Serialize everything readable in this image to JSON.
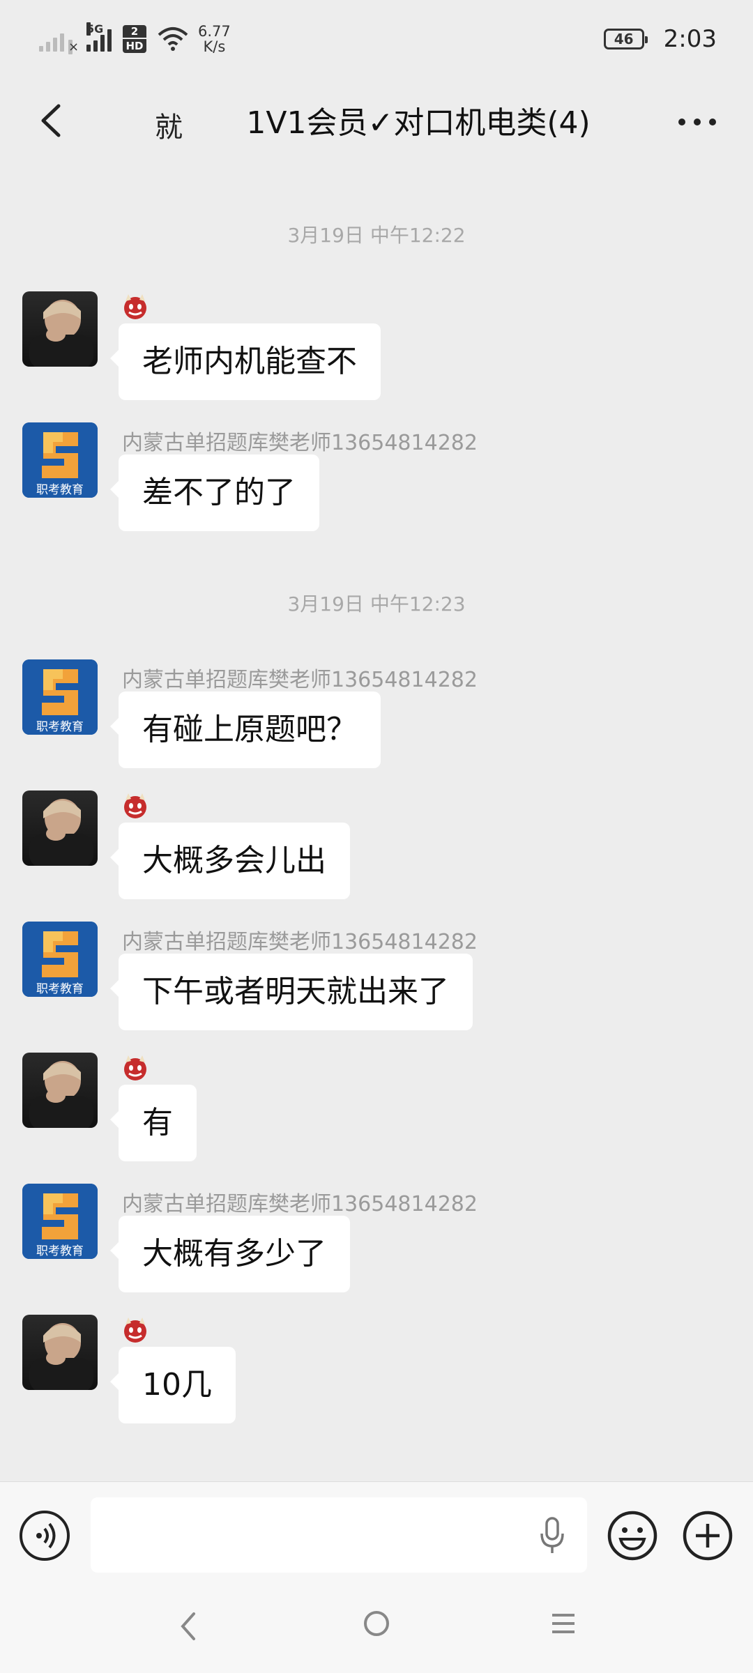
{
  "status_bar": {
    "network": "5G",
    "sim2_badge": "2",
    "sim2_hd": "HD",
    "speed_value": "6.77",
    "speed_unit": "K/s",
    "battery": "46",
    "time": "2:03"
  },
  "header": {
    "stray_char": "就",
    "title": "1V1会员✓对口机电类(4)"
  },
  "messages": [
    {
      "type": "time",
      "text": "3月19日 中午12:22"
    },
    {
      "type": "msg",
      "from": "user",
      "sender": "",
      "text": "老师内机能查不"
    },
    {
      "type": "msg",
      "from": "org",
      "sender": "内蒙古单招题库樊老师13654814282",
      "text": "差不了的了"
    },
    {
      "type": "time",
      "text": "3月19日 中午12:23"
    },
    {
      "type": "msg",
      "from": "org",
      "sender": "内蒙古单招题库樊老师13654814282",
      "text": "有碰上原题吧？"
    },
    {
      "type": "msg",
      "from": "user",
      "sender": "",
      "text": "大概多会儿出"
    },
    {
      "type": "msg",
      "from": "org",
      "sender": "内蒙古单招题库樊老师13654814282",
      "text": "下午或者明天就出来了"
    },
    {
      "type": "msg",
      "from": "user",
      "sender": "",
      "text": "有"
    },
    {
      "type": "msg",
      "from": "org",
      "sender": "内蒙古单招题库樊老师13654814282",
      "text": "大概有多少了"
    },
    {
      "type": "msg",
      "from": "user",
      "sender": "",
      "text": "10几"
    }
  ],
  "org_avatar_text": "职考教育",
  "colors": {
    "background": "#ededed",
    "bubble": "#ffffff",
    "org_blue": "#1c5aa8",
    "org_orange": "#f2a23a",
    "timestamp": "#a8a8a8"
  }
}
